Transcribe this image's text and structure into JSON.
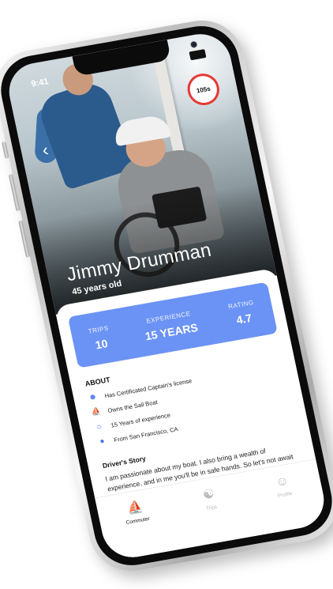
{
  "status_bar": {
    "time": "9:41"
  },
  "header": {
    "timer_badge": "105s",
    "driver_name": "Jimmy Drumman",
    "driver_age": "45 years old"
  },
  "stats": [
    {
      "label": "TRIPS",
      "value": "10"
    },
    {
      "label": "EXPERIENCE",
      "value": "15 YEARS"
    },
    {
      "label": "RATING",
      "value": "4.7"
    }
  ],
  "about": {
    "title": "ABOUT",
    "items": [
      {
        "icon": "user-check-icon",
        "text": "Has Certificated Captain's license"
      },
      {
        "icon": "boat-icon",
        "text": "Owns the Sail Boat"
      },
      {
        "icon": "sun-icon",
        "text": "15 Years of experience"
      },
      {
        "icon": "location-pin-icon",
        "text": "From San Francisco, CA"
      }
    ]
  },
  "story": {
    "title": "Driver's Story",
    "text": "I am passionate about my boat. I also bring a wealth of experience, and in me you'll be in safe hands. So let's not await around, and come aboard!"
  },
  "tabs": [
    {
      "label": "Commuter",
      "icon": "boat-icon",
      "active": true
    },
    {
      "label": "Trips",
      "icon": "globe-icon",
      "active": false
    },
    {
      "label": "Profile",
      "icon": "person-icon",
      "active": false
    }
  ],
  "colors": {
    "accent": "#6b93f5",
    "timer_ring": "#e53935"
  }
}
